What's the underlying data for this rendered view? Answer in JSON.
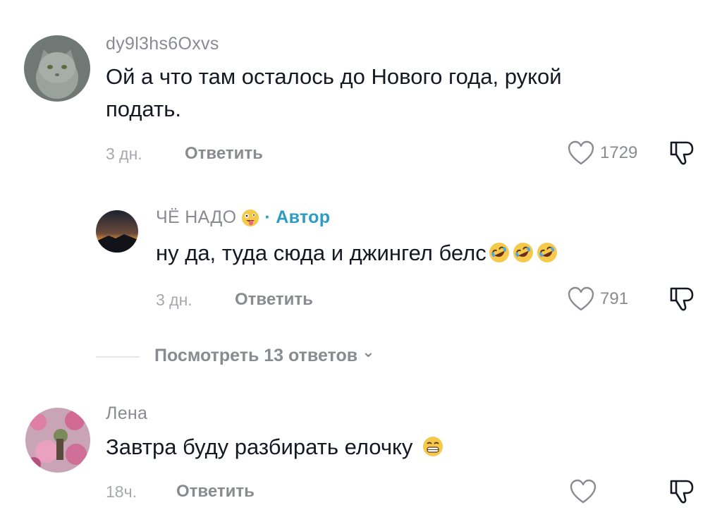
{
  "comments": [
    {
      "username": "dy9l3hs6Oxvs",
      "text_line1": "Ой а что там осталось до Нового года, рукой",
      "text_line2": "подать.",
      "time": "3 дн.",
      "reply_label": "Ответить",
      "likes": "1729"
    },
    {
      "username": "ЧЁ НАДО",
      "author_badge": "· Автор",
      "text": "ну да, туда сюда и джингел белс",
      "time": "3 дн.",
      "reply_label": "Ответить",
      "likes": "791"
    },
    {
      "username": "Лена",
      "text": "Завтра буду разбирать елочку",
      "time": "18ч.",
      "reply_label": "Ответить",
      "likes": ""
    }
  ],
  "view_replies": {
    "label": "Посмотреть 13 ответов",
    "chevron": "⌄"
  },
  "icons": {
    "like": "heart-outline-icon",
    "dislike": "thumbs-down-outline-icon",
    "emoji_tongue": "zany-face-emoji",
    "emoji_laugh": "rolling-on-floor-laughing-emoji",
    "emoji_grin": "grinning-face-emoji"
  },
  "colors": {
    "author_badge": "#2b9cc4",
    "secondary_text": "#8a8b91"
  }
}
